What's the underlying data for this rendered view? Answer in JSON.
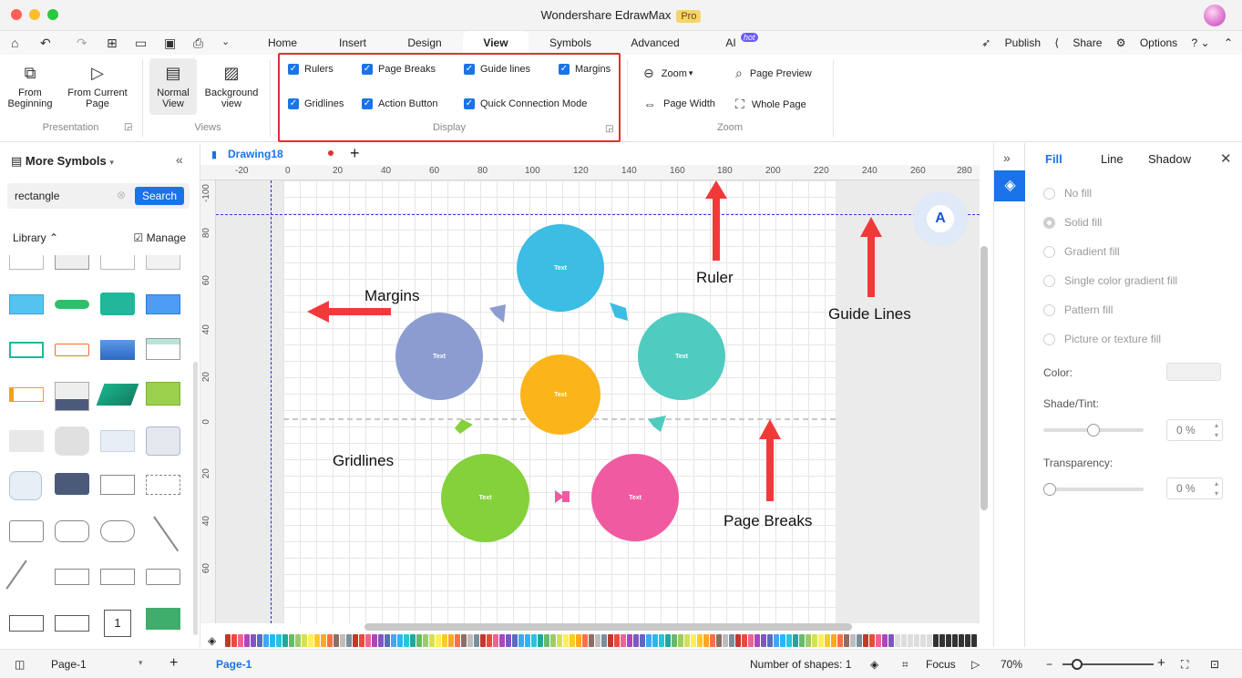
{
  "window": {
    "title": "Wondershare EdrawMax",
    "badge": "Pro"
  },
  "menu": {
    "tabs": [
      "Home",
      "Insert",
      "Design",
      "View",
      "Symbols",
      "Advanced",
      "AI"
    ],
    "active": "View",
    "hot_badge": "hot",
    "right": {
      "publish": "Publish",
      "share": "Share",
      "options": "Options"
    }
  },
  "ribbon": {
    "presentation": {
      "from_beginning": "From Beginning",
      "from_current": "From Current Page",
      "label": "Presentation"
    },
    "views": {
      "normal": "Normal View",
      "background": "Background view",
      "label": "Views"
    },
    "display": {
      "label": "Display",
      "options": [
        "Rulers",
        "Page Breaks",
        "Guide lines",
        "Margins",
        "Gridlines",
        "Action Button",
        "Quick Connection Mode"
      ]
    },
    "zoom": {
      "zoom": "Zoom",
      "page_preview": "Page Preview",
      "page_width": "Page Width",
      "whole_page": "Whole Page",
      "label": "Zoom"
    }
  },
  "left_panel": {
    "title": "More Symbols",
    "search_value": "rectangle",
    "search_button": "Search",
    "library_label": "Library",
    "manage_label": "Manage",
    "numbered_shape": "1"
  },
  "document": {
    "tab_name": "Drawing18"
  },
  "rulers": {
    "h_ticks": [
      "-20",
      "0",
      "20",
      "40",
      "60",
      "80",
      "100",
      "120",
      "140",
      "160",
      "180",
      "200",
      "220",
      "240",
      "260",
      "280"
    ],
    "v_ticks": [
      "-100",
      "80",
      "60",
      "40",
      "20",
      "0",
      "20",
      "40",
      "60"
    ]
  },
  "canvas": {
    "circle_label": "Text",
    "annotations": {
      "margins": "Margins",
      "ruler": "Ruler",
      "guide_lines": "Guide Lines",
      "gridlines": "Gridlines",
      "page_breaks": "Page Breaks"
    },
    "colors": {
      "blue": "#3bbde4",
      "teal": "#4fcbbf",
      "purple": "#8b9dd0",
      "orange": "#fbb41a",
      "green": "#84d13b",
      "pink": "#ef5aa0",
      "arrow": "#f03a3a"
    }
  },
  "right_panel": {
    "tabs": [
      "Fill",
      "Line",
      "Shadow"
    ],
    "fill_options": [
      "No fill",
      "Solid fill",
      "Gradient fill",
      "Single color gradient fill",
      "Pattern fill",
      "Picture or texture fill"
    ],
    "color_label": "Color:",
    "shade_label": "Shade/Tint:",
    "shade_value": "0 %",
    "transparency_label": "Transparency:",
    "transparency_value": "0 %"
  },
  "status": {
    "page_select": "Page-1",
    "page_tab": "Page-1",
    "shapes": "Number of shapes: 1",
    "focus": "Focus",
    "zoom": "70%"
  }
}
